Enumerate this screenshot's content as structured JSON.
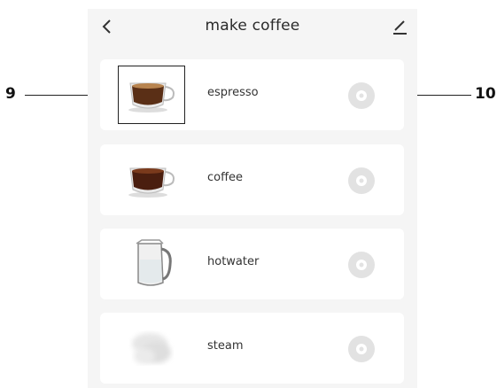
{
  "header": {
    "title": "make coffee",
    "back_icon": "chevron-left-icon",
    "edit_icon": "edit-pencil-icon"
  },
  "items": [
    {
      "label": "espresso",
      "image": "espresso-cup-icon",
      "selected": true
    },
    {
      "label": "coffee",
      "image": "coffee-cup-icon",
      "selected": false
    },
    {
      "label": "hotwater",
      "image": "water-jug-icon",
      "selected": false
    },
    {
      "label": "steam",
      "image": "steam-icon",
      "selected": false
    }
  ],
  "callouts": {
    "left": "9",
    "right": "10"
  },
  "colors": {
    "background": "#f5f5f5",
    "card": "#ffffff",
    "settings_button": "#e2e2e2"
  }
}
